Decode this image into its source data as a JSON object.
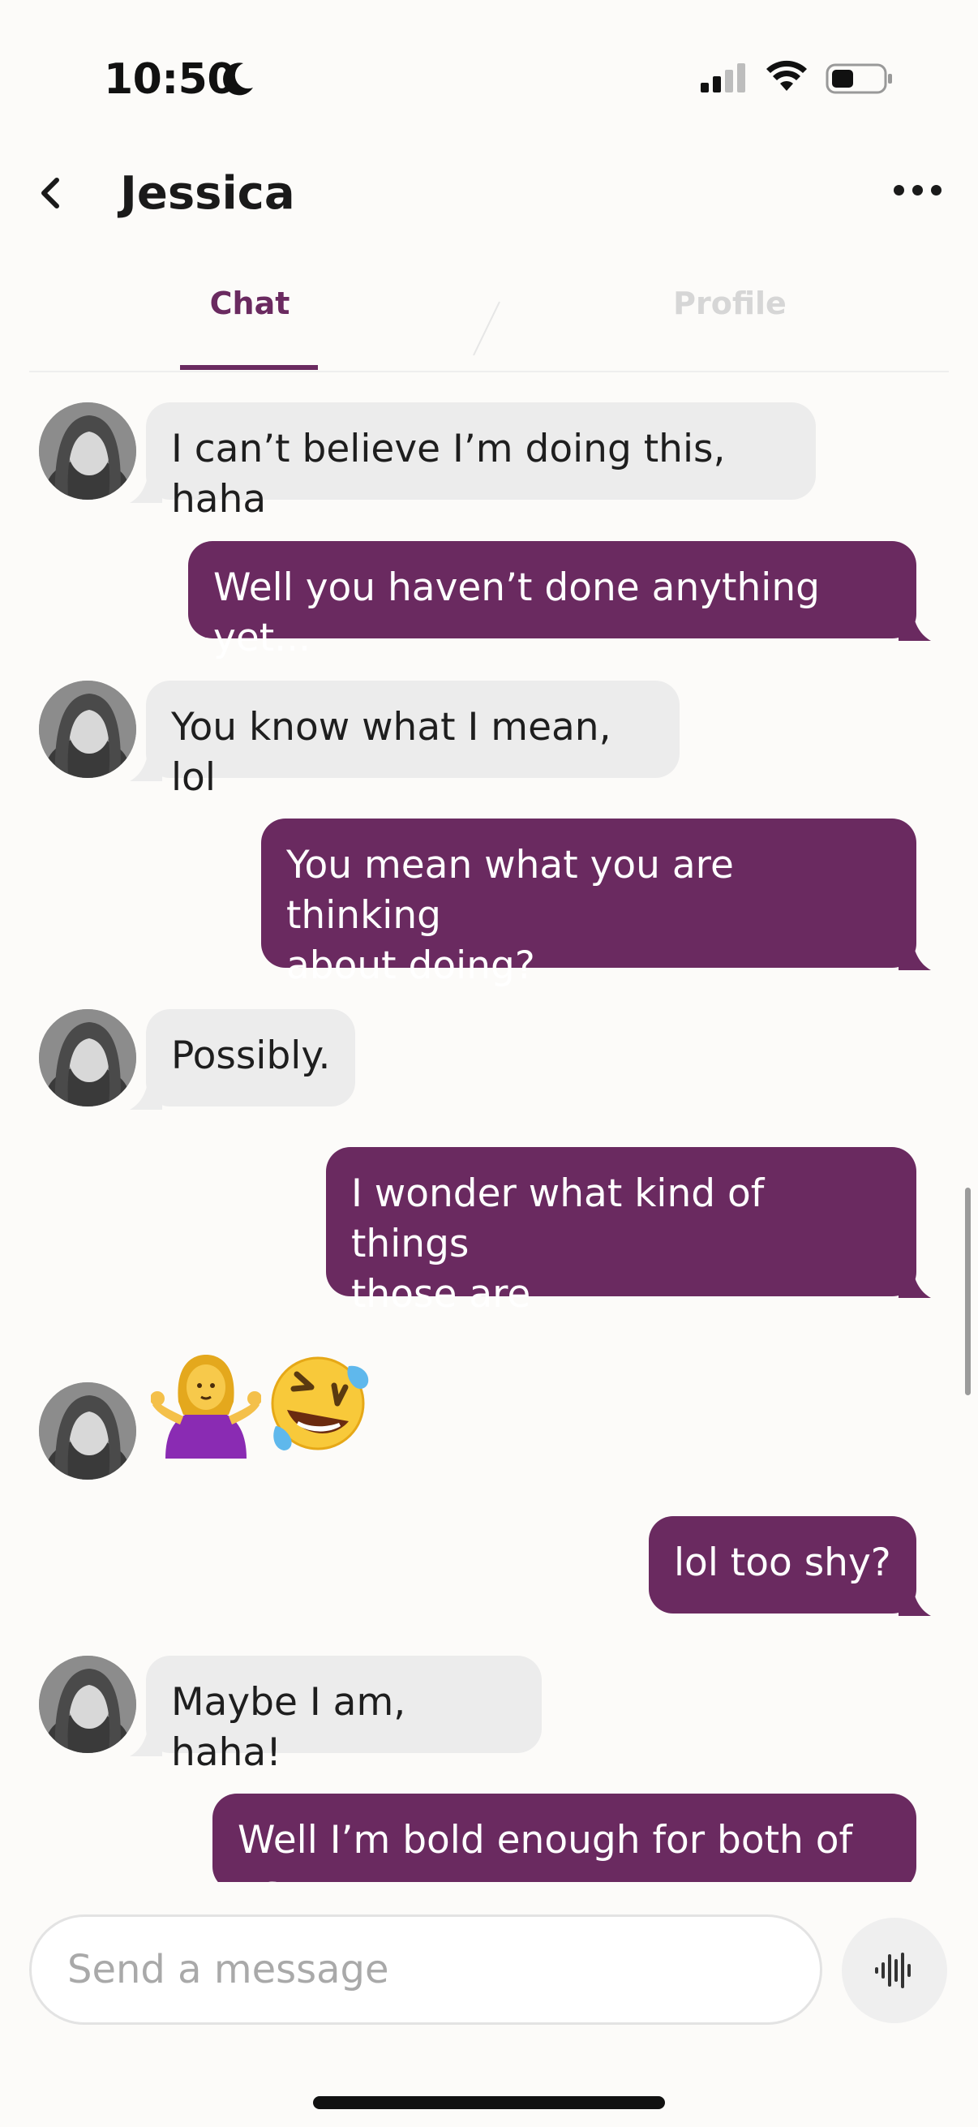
{
  "status_bar": {
    "time": "10:50"
  },
  "header": {
    "title": "Jessica"
  },
  "tabs": [
    {
      "label": "Chat",
      "active": true
    },
    {
      "label": "Profile",
      "active": false
    }
  ],
  "messages": [
    {
      "from": "them",
      "text": "I can’t believe I’m doing this, haha"
    },
    {
      "from": "me",
      "text": "Well you haven’t done anything yet..."
    },
    {
      "from": "them",
      "text": "You know what I mean, lol"
    },
    {
      "from": "me",
      "text": "You mean what you are thinking\nabout doing?"
    },
    {
      "from": "them",
      "text": "Possibly."
    },
    {
      "from": "me",
      "text": "I wonder what kind of things\nthose are"
    },
    {
      "from": "them",
      "emoji": [
        "person-shrugging",
        "rolling-on-the-floor-laughing"
      ]
    },
    {
      "from": "me",
      "text": "lol too shy?"
    },
    {
      "from": "them",
      "text": "Maybe I am, haha!"
    },
    {
      "from": "me",
      "text": "Well I’m bold enough for both of us"
    }
  ],
  "composer": {
    "placeholder": "Send a message"
  },
  "colors": {
    "accent": "#6a2a60",
    "incoming_bubble": "#ececec",
    "tab_inactive": "#d6d6d6"
  }
}
